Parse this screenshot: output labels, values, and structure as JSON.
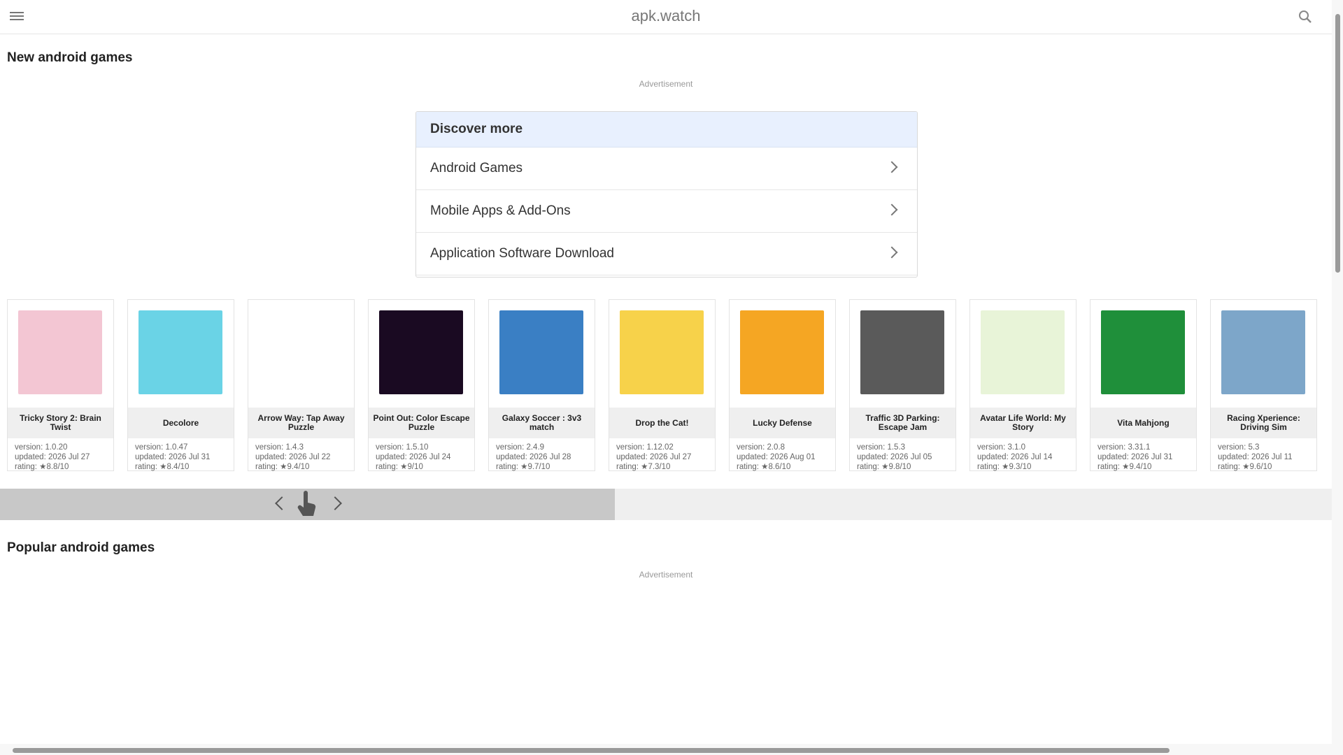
{
  "header": {
    "title": "apk.watch",
    "menu_icon": "hamburger-menu-icon",
    "search_icon": "search-icon"
  },
  "sections": {
    "new": {
      "title": "New android games",
      "ad_label": "Advertisement"
    },
    "popular": {
      "title": "Popular android games",
      "ad_label": "Advertisement"
    }
  },
  "discover": {
    "title": "Discover more",
    "items": [
      {
        "label": "Android Games"
      },
      {
        "label": "Mobile Apps & Add-Ons"
      },
      {
        "label": "Application Software Download"
      }
    ]
  },
  "apps": [
    {
      "name": "Tricky Story 2: Brain Twist",
      "version": "version: 1.0.20",
      "updated": "updated: 2026 Jul 27",
      "rating": "rating: ★8.8/10",
      "color": "#f3c6d3"
    },
    {
      "name": "Decolore",
      "version": "version: 1.0.47",
      "updated": "updated: 2026 Jul 31",
      "rating": "rating: ★8.4/10",
      "color": "#6ad3e6"
    },
    {
      "name": "Arrow Way: Tap Away Puzzle",
      "version": "version: 1.4.3",
      "updated": "updated: 2026 Jul 22",
      "rating": "rating: ★9.4/10",
      "color": "#ffffff"
    },
    {
      "name": "Point Out: Color Escape Puzzle",
      "version": "version: 1.5.10",
      "updated": "updated: 2026 Jul 24",
      "rating": "rating: ★9/10",
      "color": "#1a0a22"
    },
    {
      "name": "Galaxy Soccer : 3v3 match",
      "version": "version: 2.4.9",
      "updated": "updated: 2026 Jul 28",
      "rating": "rating: ★9.7/10",
      "color": "#3a7fc4"
    },
    {
      "name": "Drop the Cat!",
      "version": "version: 1.12.02",
      "updated": "updated: 2026 Jul 27",
      "rating": "rating: ★7.3/10",
      "color": "#f7d24a"
    },
    {
      "name": "Lucky Defense",
      "version": "version: 2.0.8",
      "updated": "updated: 2026 Aug 01",
      "rating": "rating: ★8.6/10",
      "color": "#f5a623"
    },
    {
      "name": "Traffic 3D Parking: Escape Jam",
      "version": "version: 1.5.3",
      "updated": "updated: 2026 Jul 05",
      "rating": "rating: ★9.8/10",
      "color": "#5a5a5a"
    },
    {
      "name": "Avatar Life World: My Story",
      "version": "version: 3.1.0",
      "updated": "updated: 2026 Jul 14",
      "rating": "rating: ★9.3/10",
      "color": "#e8f4d8"
    },
    {
      "name": "Vita Mahjong",
      "version": "version: 3.31.1",
      "updated": "updated: 2026 Jul 31",
      "rating": "rating: ★9.4/10",
      "color": "#1f8f3a"
    },
    {
      "name": "Racing Xperience: Driving Sim",
      "version": "version: 5.3",
      "updated": "updated: 2026 Jul 11",
      "rating": "rating: ★9.6/10",
      "color": "#7da6c9"
    }
  ]
}
